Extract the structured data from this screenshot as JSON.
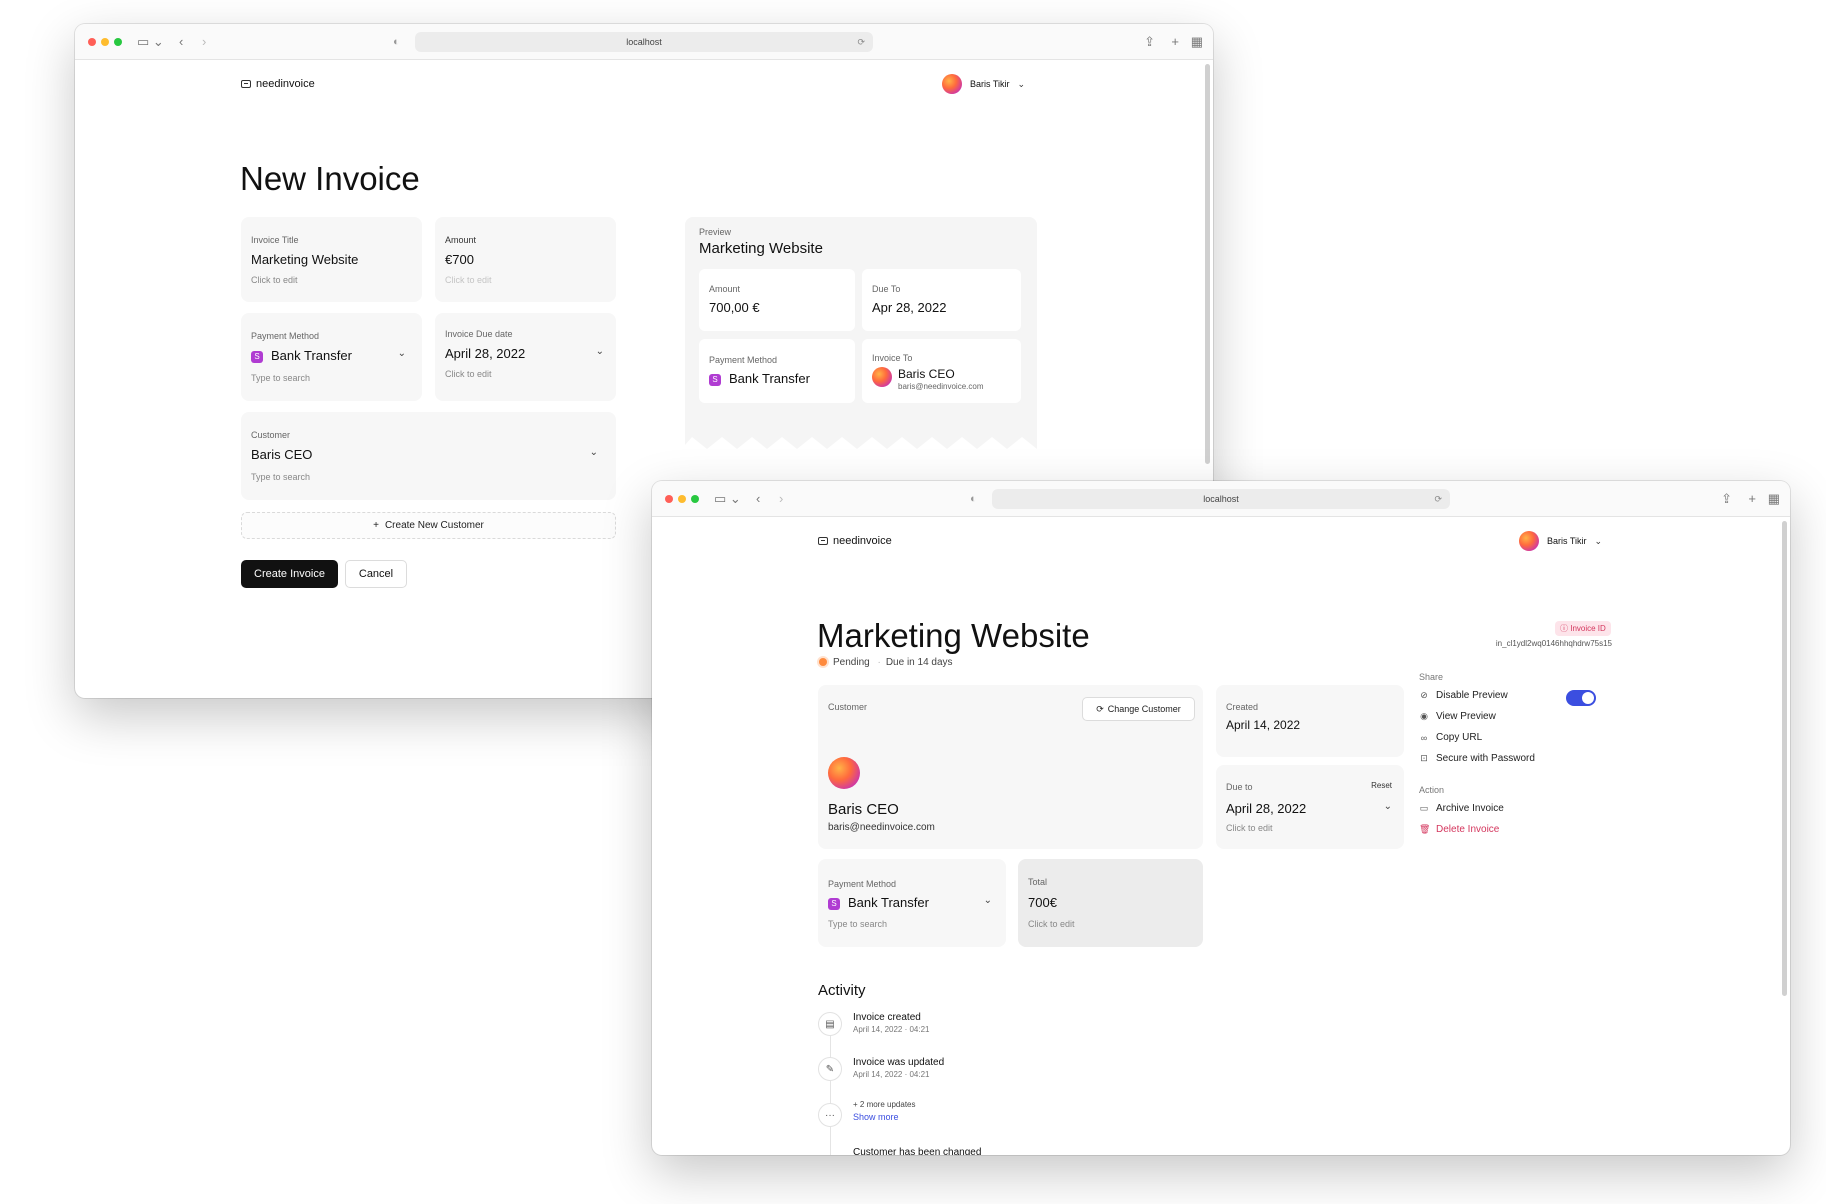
{
  "browser": {
    "url": "localhost"
  },
  "app": {
    "logo": "needinvoice",
    "user_name": "Baris Tikir"
  },
  "new_invoice": {
    "title": "New Invoice",
    "invoice_title": {
      "label": "Invoice Title",
      "value": "Marketing Website",
      "hint": "Click to edit"
    },
    "amount": {
      "label": "Amount",
      "value": "€700",
      "hint": "Click to edit"
    },
    "payment_method": {
      "label": "Payment Method",
      "value": "Bank Transfer",
      "hint": "Type to search"
    },
    "due_date": {
      "label": "Invoice Due date",
      "value": "April 28, 2022",
      "hint": "Click to edit"
    },
    "customer": {
      "label": "Customer",
      "value": "Baris CEO",
      "hint": "Type to search"
    },
    "create_new_customer": "Create New Customer",
    "create_button": "Create Invoice",
    "cancel_button": "Cancel",
    "preview": {
      "label": "Preview",
      "title": "Marketing Website",
      "amount_label": "Amount",
      "amount_value": "700,00 €",
      "due_label": "Due To",
      "due_value": "Apr 28, 2022",
      "payment_label": "Payment Method",
      "payment_value": "Bank Transfer",
      "invoice_to_label": "Invoice To",
      "invoice_to_name": "Baris CEO",
      "invoice_to_email": "baris@needinvoice.com"
    }
  },
  "invoice_detail": {
    "title": "Marketing Website",
    "status": "Pending",
    "due_text": "Due in 14 days",
    "invoice_id_badge": "Invoice ID",
    "invoice_id": "in_cl1ydl2wq0146hhqhdrw75s15",
    "customer": {
      "label": "Customer",
      "change_button": "Change Customer",
      "name": "Baris CEO",
      "email": "baris@needinvoice.com"
    },
    "created": {
      "label": "Created",
      "value": "April 14, 2022"
    },
    "due_to": {
      "label": "Due to",
      "reset": "Reset",
      "value": "April 28, 2022",
      "hint": "Click to edit"
    },
    "payment_method": {
      "label": "Payment Method",
      "value": "Bank Transfer",
      "hint": "Type to search"
    },
    "total": {
      "label": "Total",
      "value": "700€",
      "hint": "Click to edit"
    },
    "share": {
      "heading": "Share",
      "disable_preview": "Disable Preview",
      "view_preview": "View Preview",
      "copy_url": "Copy URL",
      "secure_password": "Secure with Password"
    },
    "action": {
      "heading": "Action",
      "archive": "Archive Invoice",
      "delete": "Delete Invoice"
    },
    "activity": {
      "heading": "Activity",
      "items": [
        {
          "title": "Invoice created",
          "time": "April 14, 2022 · 04:21"
        },
        {
          "title": "Invoice was updated",
          "time": "April 14, 2022 · 04:21"
        }
      ],
      "more_updates": "+ 2 more updates",
      "show_more": "Show more",
      "last_title": "Customer has been changed"
    }
  },
  "colors": {
    "accent": "#3b4ee0",
    "danger": "#d4365d",
    "pending": "#ff8a3d",
    "payment_icon": "#b03cd2"
  },
  "icons": [
    "logo-icon",
    "sidebar-icon",
    "back-icon",
    "forward-icon",
    "share-icon",
    "new-tab-icon",
    "tabs-icon",
    "chevron-down-icon",
    "plus-icon",
    "refresh-icon",
    "eye-off-icon",
    "eye-icon",
    "link-icon",
    "lock-icon",
    "folder-icon",
    "trash-icon",
    "document-icon",
    "pencil-icon",
    "more-icon"
  ]
}
